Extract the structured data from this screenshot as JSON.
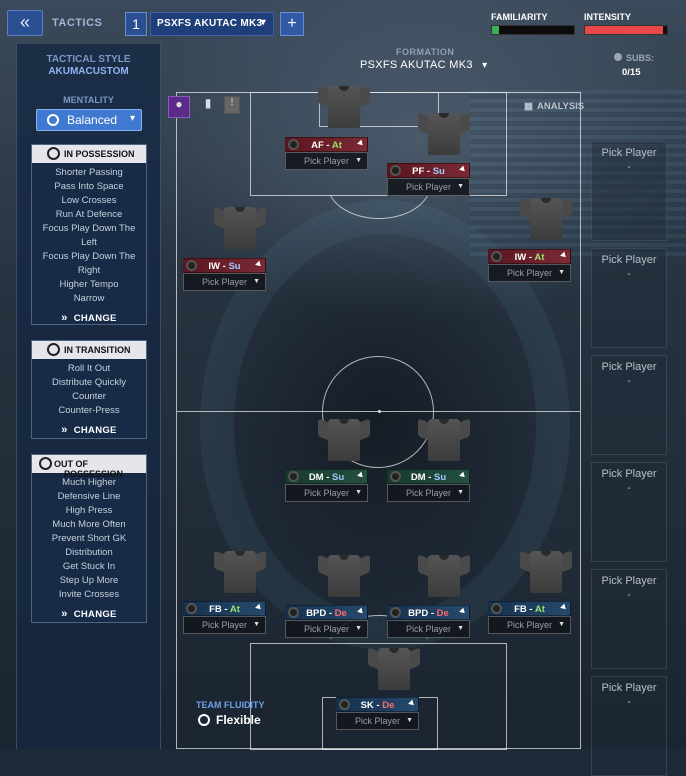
{
  "header": {
    "back_icon": "chevron-double-left-icon",
    "title": "TACTICS",
    "tactic_slot": "1",
    "tactic_name": "PSXFS AKUTAC MK3",
    "add_icon": "plus-icon",
    "familiarity_label": "FAMILIARITY",
    "familiarity_level": 0.08,
    "intensity_label": "INTENSITY",
    "intensity_level": 0.95
  },
  "sidebar": {
    "style_label": "TACTICAL STYLE",
    "style_value": "AKUMACUSTOM",
    "mentality_label": "MENTALITY",
    "mentality_value": "Balanced",
    "in_possession": {
      "title": "IN POSSESSION",
      "items": [
        "Shorter Passing",
        "Pass Into Space",
        "Low Crosses",
        "Run At Defence",
        "Focus Play Down The Left",
        "Focus Play Down The Right",
        "Higher Tempo",
        "Narrow"
      ],
      "change": "CHANGE"
    },
    "in_transition": {
      "title": "IN TRANSITION",
      "items": [
        "Roll It Out",
        "Distribute Quickly",
        "Counter",
        "Counter-Press"
      ],
      "change": "CHANGE"
    },
    "out_of_possession": {
      "title": "OUT OF POSSESSION",
      "items": [
        "Much Higher",
        "Defensive Line",
        "High Press",
        "Much More Often",
        "Prevent Short GK",
        "Distribution",
        "Get Stuck In",
        "Step Up More",
        "Invite Crosses"
      ],
      "change": "CHANGE"
    }
  },
  "formation": {
    "label": "FORMATION",
    "value": "PSXFS AKUTAC MK3",
    "subs_label": "SUBS:",
    "subs_value": "0/15",
    "analysis": "ANALYSIS"
  },
  "players": [
    {
      "role": "AF",
      "duty": "At",
      "pick": "Pick Player",
      "color": "red"
    },
    {
      "role": "PF",
      "duty": "Su",
      "pick": "Pick Player",
      "color": "red"
    },
    {
      "role": "IW",
      "duty": "Su",
      "pick": "Pick Player",
      "color": "red"
    },
    {
      "role": "IW",
      "duty": "At",
      "pick": "Pick Player",
      "color": "red"
    },
    {
      "role": "DM",
      "duty": "Su",
      "pick": "Pick Player",
      "color": "green"
    },
    {
      "role": "DM",
      "duty": "Su",
      "pick": "Pick Player",
      "color": "green"
    },
    {
      "role": "FB",
      "duty": "At",
      "pick": "Pick Player",
      "color": "blue"
    },
    {
      "role": "BPD",
      "duty": "De",
      "pick": "Pick Player",
      "color": "blue"
    },
    {
      "role": "BPD",
      "duty": "De",
      "pick": "Pick Player",
      "color": "blue"
    },
    {
      "role": "FB",
      "duty": "At",
      "pick": "Pick Player",
      "color": "blue"
    },
    {
      "role": "SK",
      "duty": "De",
      "pick": "Pick Player",
      "color": "blue"
    }
  ],
  "bench": [
    {
      "label": "Pick Player",
      "dash": "-"
    },
    {
      "label": "Pick Player",
      "dash": "-"
    },
    {
      "label": "Pick Player",
      "dash": "-"
    },
    {
      "label": "Pick Player",
      "dash": "-"
    },
    {
      "label": "Pick Player",
      "dash": "-"
    },
    {
      "label": "Pick Player",
      "dash": "-"
    }
  ],
  "fluidity": {
    "label": "TEAM FLUIDITY",
    "value": "Flexible"
  },
  "colors": {
    "accent_blue": "#2a4f92",
    "attack_red": "#7a2a34",
    "midfield_green": "#24503f",
    "defence_blue": "#264a6c"
  }
}
